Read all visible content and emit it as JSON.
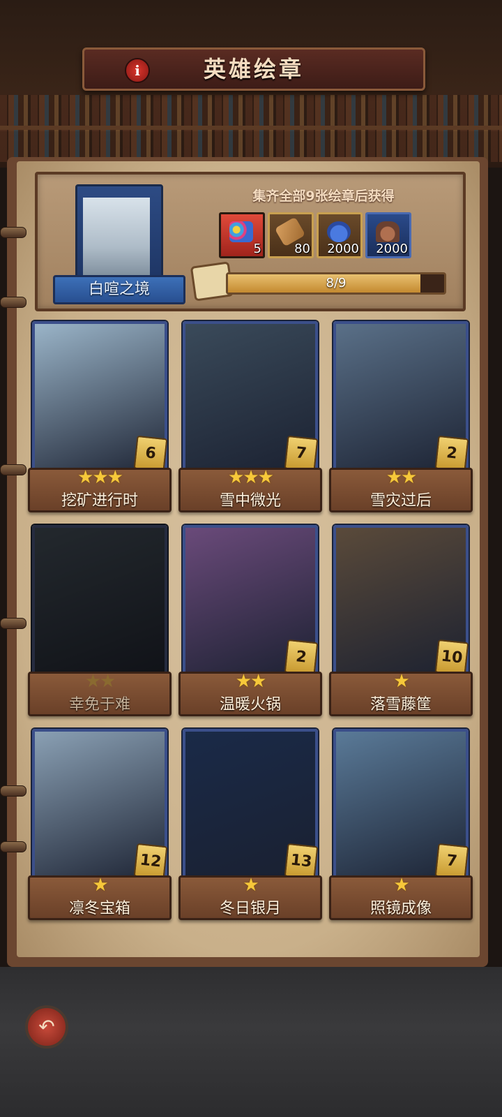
{
  "header": {
    "title": "英雄绘章",
    "info_glyph": "i"
  },
  "collection": {
    "album_name": "白喧之境",
    "reward_title": "集齐全部9张绘章后获得",
    "rewards": [
      {
        "icon": "gem-bag-icon",
        "count": "5",
        "color": "#c8302a"
      },
      {
        "icon": "scroll-icon",
        "count": "80",
        "color": "#c8a050"
      },
      {
        "icon": "potion-icon",
        "count": "2000",
        "color": "#c8a050"
      },
      {
        "icon": "ore-icon",
        "count": "2000",
        "color": "#3a5a9a"
      }
    ],
    "progress_text": "8/9",
    "progress_fraction": 0.889
  },
  "cards": [
    {
      "name": "挖矿进行时",
      "stars": "★★★",
      "star_count": 3,
      "count": "6",
      "locked": false,
      "theme": "#9ab4c8"
    },
    {
      "name": "雪中微光",
      "stars": "★★★",
      "star_count": 3,
      "count": "7",
      "locked": false,
      "theme": "#3a4a5a"
    },
    {
      "name": "雪灾过后",
      "stars": "★★",
      "star_count": 2,
      "count": "2",
      "locked": false,
      "theme": "#5a7088"
    },
    {
      "name": "幸免于难",
      "stars": "★★",
      "star_count": 2,
      "count": "",
      "locked": true,
      "theme": "#3a4a5a"
    },
    {
      "name": "温暖火锅",
      "stars": "★★",
      "star_count": 2,
      "count": "2",
      "locked": false,
      "theme": "#6a4a7a"
    },
    {
      "name": "落雪藤筐",
      "stars": "★",
      "star_count": 1,
      "count": "10",
      "locked": false,
      "theme": "#5a4a3a"
    },
    {
      "name": "凛冬宝箱",
      "stars": "★",
      "star_count": 1,
      "count": "12",
      "locked": false,
      "theme": "#8aa0b4"
    },
    {
      "name": "冬日银月",
      "stars": "★",
      "star_count": 1,
      "count": "13",
      "locked": false,
      "theme": "#1a2a48"
    },
    {
      "name": "照镜成像",
      "stars": "★",
      "star_count": 1,
      "count": "7",
      "locked": false,
      "theme": "#5a7a98"
    }
  ],
  "footer": {
    "back_glyph": "↶"
  }
}
